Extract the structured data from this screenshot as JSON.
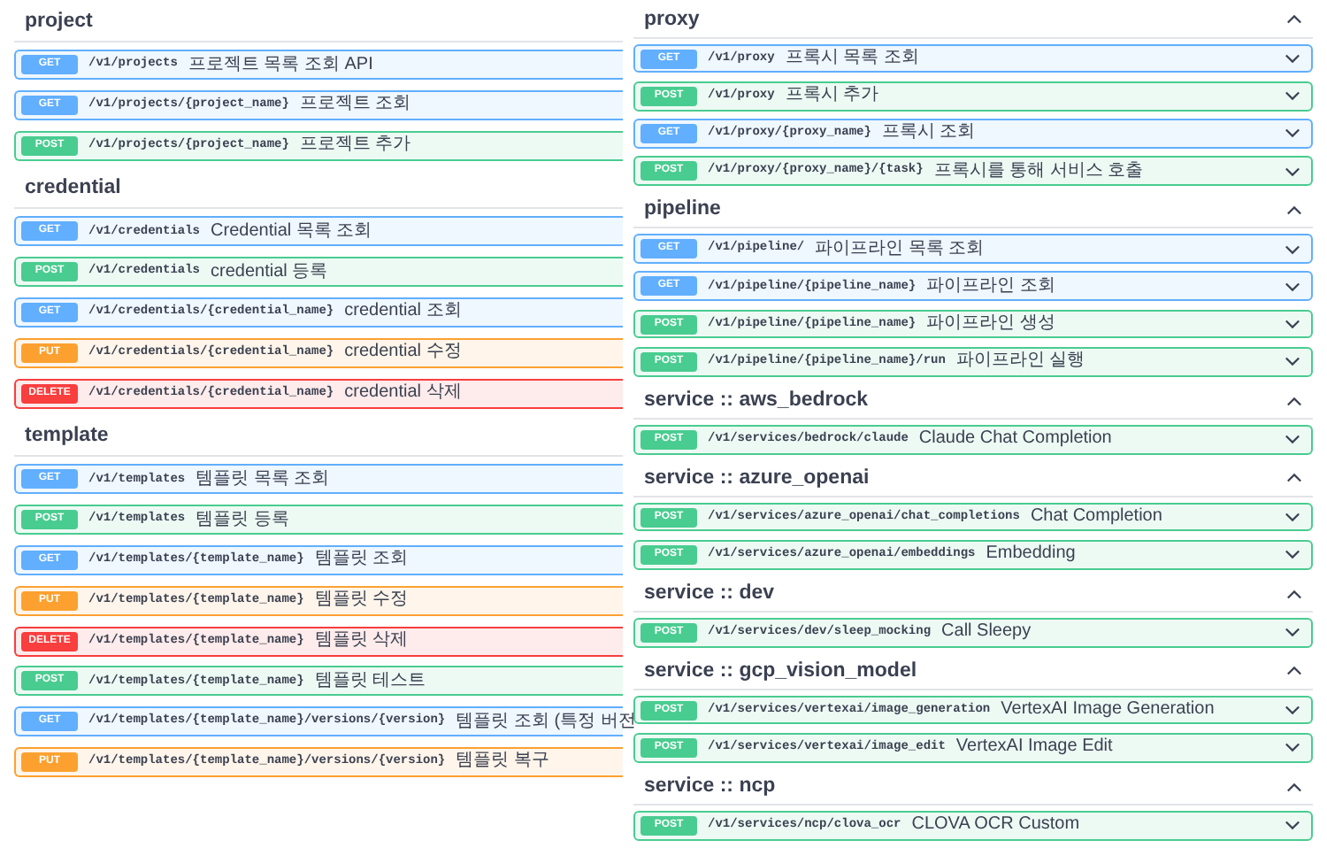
{
  "left_panel": {
    "groups": [
      {
        "title": "project",
        "operations": [
          {
            "kind": "get",
            "method": "GET",
            "path": "/v1/projects",
            "summary": "프로젝트 목록 조회 API"
          },
          {
            "kind": "get",
            "method": "GET",
            "path": "/v1/projects/{project_name}",
            "summary": "프로젝트 조회"
          },
          {
            "kind": "post",
            "method": "POST",
            "path": "/v1/projects/{project_name}",
            "summary": "프로젝트 추가"
          }
        ]
      },
      {
        "title": "credential",
        "operations": [
          {
            "kind": "get",
            "method": "GET",
            "path": "/v1/credentials",
            "summary": "Credential 목록 조회"
          },
          {
            "kind": "post",
            "method": "POST",
            "path": "/v1/credentials",
            "summary": "credential 등록"
          },
          {
            "kind": "get",
            "method": "GET",
            "path": "/v1/credentials/{credential_name}",
            "summary": "credential 조회"
          },
          {
            "kind": "put",
            "method": "PUT",
            "path": "/v1/credentials/{credential_name}",
            "summary": "credential 수정"
          },
          {
            "kind": "delete",
            "method": "DELETE",
            "path": "/v1/credentials/{credential_name}",
            "summary": "credential 삭제"
          }
        ]
      },
      {
        "title": "template",
        "operations": [
          {
            "kind": "get",
            "method": "GET",
            "path": "/v1/templates",
            "summary": "템플릿 목록 조회"
          },
          {
            "kind": "post",
            "method": "POST",
            "path": "/v1/templates",
            "summary": "템플릿 등록"
          },
          {
            "kind": "get",
            "method": "GET",
            "path": "/v1/templates/{template_name}",
            "summary": "템플릿 조회"
          },
          {
            "kind": "put",
            "method": "PUT",
            "path": "/v1/templates/{template_name}",
            "summary": "템플릿 수정"
          },
          {
            "kind": "delete",
            "method": "DELETE",
            "path": "/v1/templates/{template_name}",
            "summary": "템플릿 삭제"
          },
          {
            "kind": "post",
            "method": "POST",
            "path": "/v1/templates/{template_name}",
            "summary": "템플릿 테스트"
          },
          {
            "kind": "get",
            "method": "GET",
            "path": "/v1/templates/{template_name}/versions/{version}",
            "summary": "템플릿 조회 (특정 버전"
          },
          {
            "kind": "put",
            "method": "PUT",
            "path": "/v1/templates/{template_name}/versions/{version}",
            "summary": "템플릿 복구"
          }
        ]
      }
    ]
  },
  "right_panel": {
    "groups": [
      {
        "title": "proxy",
        "expanded": true,
        "operations": [
          {
            "kind": "get",
            "method": "GET",
            "path": "/v1/proxy",
            "summary": "프록시 목록 조회",
            "expanded": false
          },
          {
            "kind": "post",
            "method": "POST",
            "path": "/v1/proxy",
            "summary": "프록시 추가",
            "expanded": false
          },
          {
            "kind": "get",
            "method": "GET",
            "path": "/v1/proxy/{proxy_name}",
            "summary": "프록시 조회",
            "expanded": false
          },
          {
            "kind": "post",
            "method": "POST",
            "path": "/v1/proxy/{proxy_name}/{task}",
            "summary": "프록시를 통해 서비스 호출",
            "expanded": false
          }
        ]
      },
      {
        "title": "pipeline",
        "expanded": true,
        "operations": [
          {
            "kind": "get",
            "method": "GET",
            "path": "/v1/pipeline/",
            "summary": "파이프라인 목록 조회",
            "expanded": false
          },
          {
            "kind": "get",
            "method": "GET",
            "path": "/v1/pipeline/{pipeline_name}",
            "summary": "파이프라인 조회",
            "expanded": false
          },
          {
            "kind": "post",
            "method": "POST",
            "path": "/v1/pipeline/{pipeline_name}",
            "summary": "파이프라인 생성",
            "expanded": false
          },
          {
            "kind": "post",
            "method": "POST",
            "path": "/v1/pipeline/{pipeline_name}/run",
            "summary": "파이프라인 실행",
            "expanded": false
          }
        ]
      },
      {
        "title": "service :: aws_bedrock",
        "expanded": true,
        "operations": [
          {
            "kind": "post",
            "method": "POST",
            "path": "/v1/services/bedrock/claude",
            "summary": "Claude Chat Completion",
            "expanded": false
          }
        ]
      },
      {
        "title": "service :: azure_openai",
        "expanded": true,
        "operations": [
          {
            "kind": "post",
            "method": "POST",
            "path": "/v1/services/azure_openai/chat_completions",
            "summary": "Chat Completion",
            "expanded": false
          },
          {
            "kind": "post",
            "method": "POST",
            "path": "/v1/services/azure_openai/embeddings",
            "summary": "Embedding",
            "expanded": false
          }
        ]
      },
      {
        "title": "service :: dev",
        "expanded": true,
        "operations": [
          {
            "kind": "post",
            "method": "POST",
            "path": "/v1/services/dev/sleep_mocking",
            "summary": "Call Sleepy",
            "expanded": false
          }
        ]
      },
      {
        "title": "service :: gcp_vision_model",
        "expanded": true,
        "operations": [
          {
            "kind": "post",
            "method": "POST",
            "path": "/v1/services/vertexai/image_generation",
            "summary": "VertexAI Image Generation",
            "expanded": false
          },
          {
            "kind": "post",
            "method": "POST",
            "path": "/v1/services/vertexai/image_edit",
            "summary": "VertexAI Image Edit",
            "expanded": false
          }
        ]
      },
      {
        "title": "service :: ncp",
        "expanded": true,
        "operations": [
          {
            "kind": "post",
            "method": "POST",
            "path": "/v1/services/ncp/clova_ocr",
            "summary": "CLOVA OCR Custom",
            "expanded": false
          }
        ]
      }
    ]
  }
}
